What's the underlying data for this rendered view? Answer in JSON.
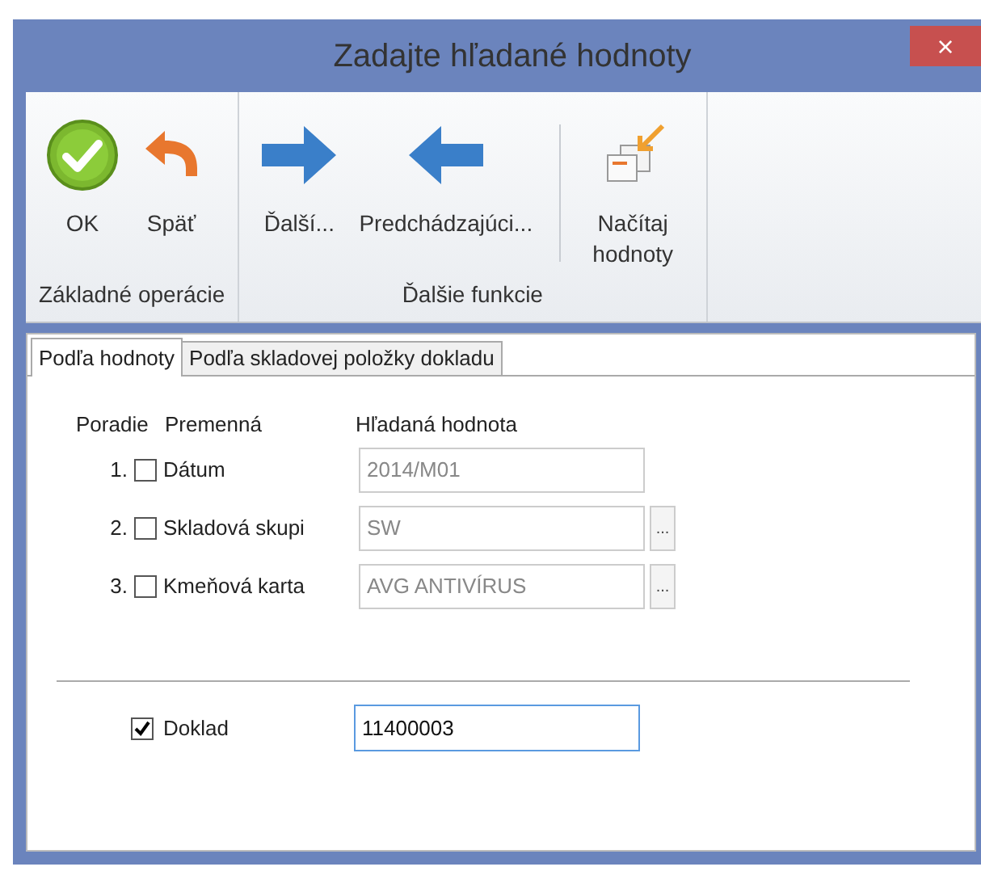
{
  "window": {
    "title": "Zadajte hľadané hodnoty",
    "close": "×"
  },
  "ribbon": {
    "groups": [
      {
        "label": "Základné operácie",
        "buttons": [
          {
            "label": "OK",
            "kind": "ok"
          },
          {
            "label": "Späť",
            "kind": "back"
          }
        ]
      },
      {
        "label": "Ďalšie funkcie",
        "buttons": [
          {
            "label": "Ďalší...",
            "kind": "next"
          },
          {
            "label": "Predchádzajúci...",
            "kind": "previous"
          },
          {
            "label": "Načítaj hodnoty",
            "kind": "load",
            "separator_before": true
          }
        ]
      }
    ]
  },
  "tabs": [
    {
      "label": "Podľa hodnoty",
      "selected": true
    },
    {
      "label": "Podľa skladovej položky dokladu",
      "selected": false
    }
  ],
  "columns": [
    "Poradie",
    "Premenná",
    "Hľadaná hodnota"
  ],
  "rows": [
    {
      "order": "1.",
      "checked": false,
      "name": "Dátum",
      "value": "2014/M01",
      "disabled": true
    },
    {
      "order": "2.",
      "checked": false,
      "name": "Skladová skupi",
      "value": "SW",
      "browse": "...",
      "disabled": true
    },
    {
      "order": "3.",
      "checked": false,
      "name": "Kmeňová karta",
      "value": "AVG ANTIVÍRUS",
      "browse": "...",
      "disabled": true
    }
  ],
  "document": {
    "checked": true,
    "label": "Doklad",
    "value": "11400003"
  }
}
